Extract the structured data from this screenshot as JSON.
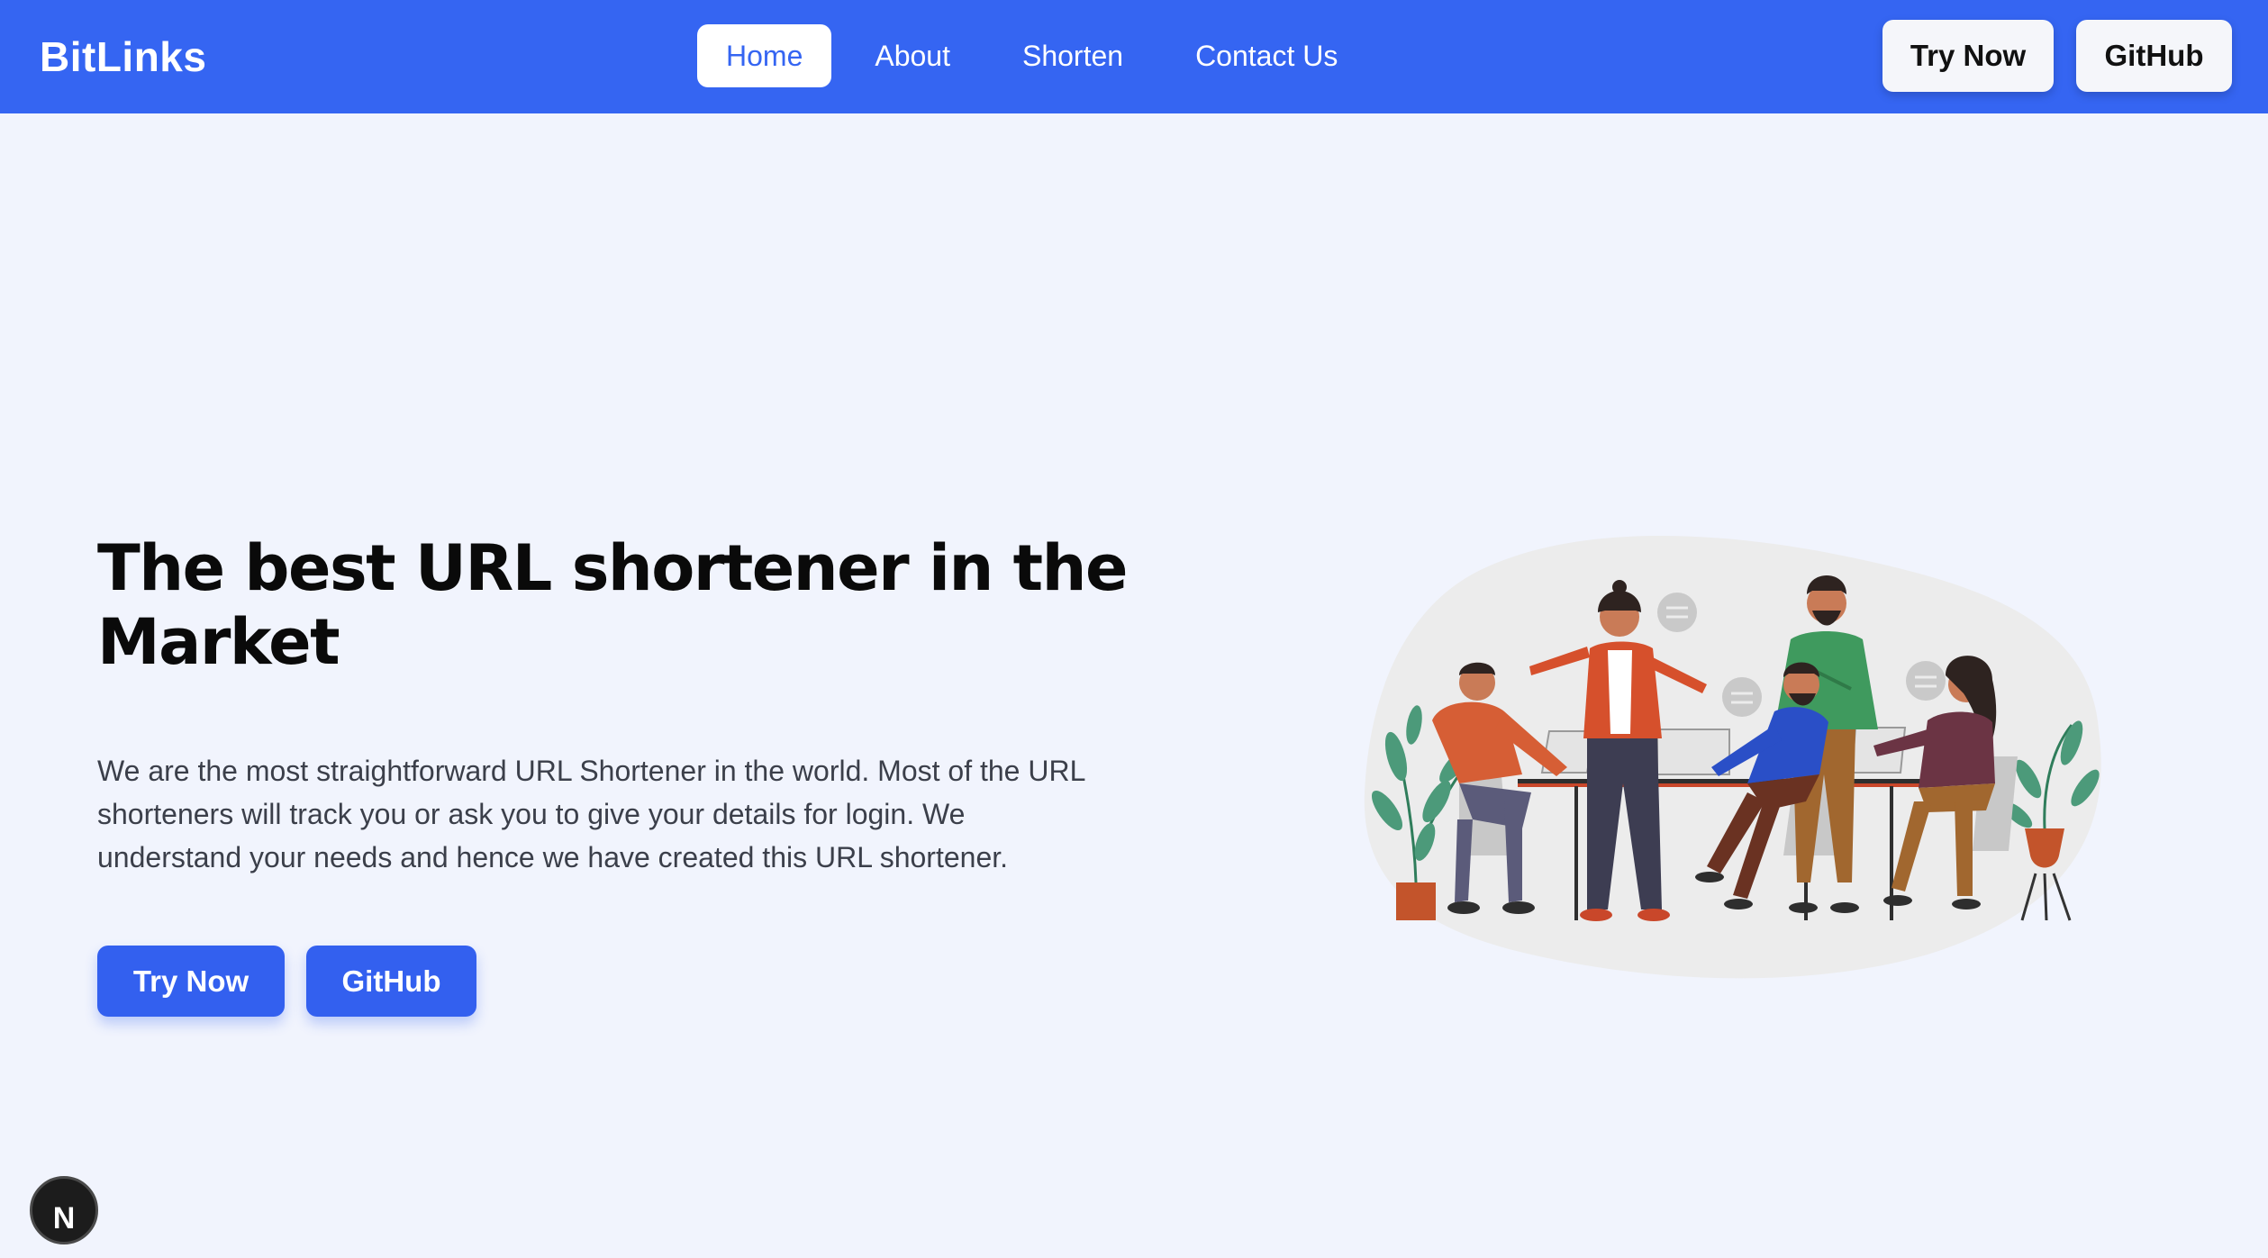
{
  "navbar": {
    "brand": "BitLinks",
    "links": [
      {
        "label": "Home",
        "active": true
      },
      {
        "label": "About",
        "active": false
      },
      {
        "label": "Shorten",
        "active": false
      },
      {
        "label": "Contact Us",
        "active": false
      }
    ],
    "try_now_label": "Try Now",
    "github_label": "GitHub"
  },
  "hero": {
    "title": "The best URL shortener in the Market",
    "description": "We are the most straightforward URL Shortener in the world. Most of the URL shorteners will track you or ask you to give your details for login. We understand your needs and hence we have created this URL shortener.",
    "try_now_label": "Try Now",
    "github_label": "GitHub"
  },
  "badge": {
    "letter": "N"
  },
  "colors": {
    "brand_blue": "#3565f2",
    "page_bg": "#f1f4fd",
    "button_blue": "#3360ef",
    "heading": "#0a0a0a",
    "body_text": "#3b3f4a"
  },
  "icons": {
    "badge_icon": "nextjs-logo-icon",
    "illustration": "team-meeting-illustration"
  }
}
